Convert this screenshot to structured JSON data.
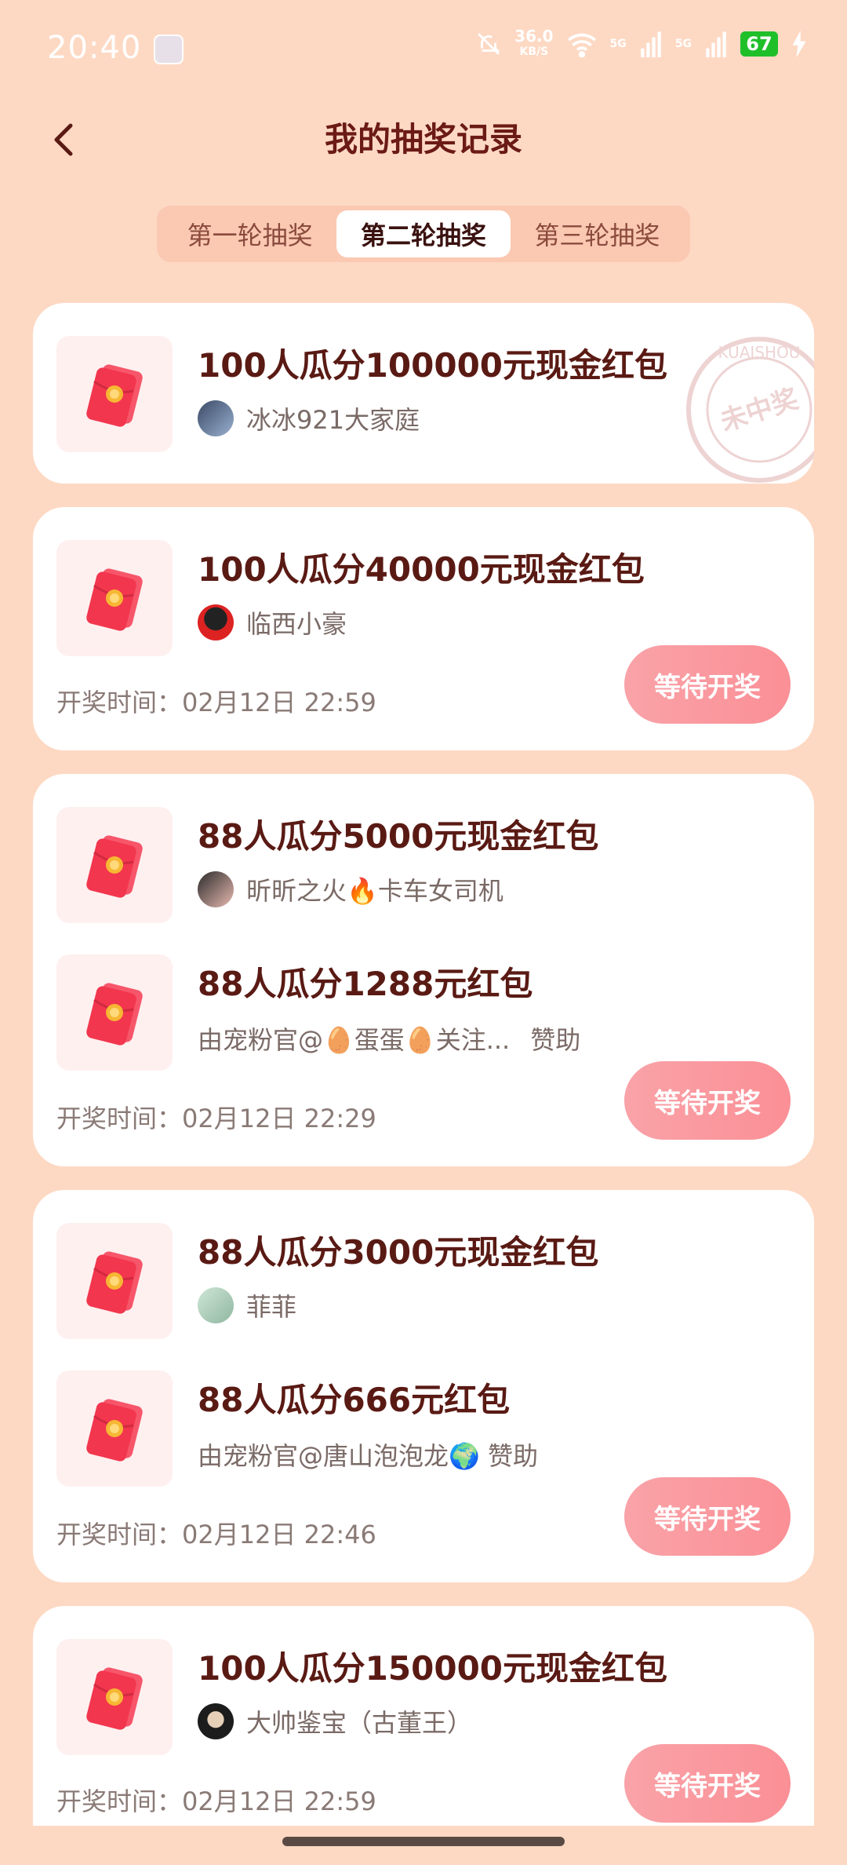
{
  "status_bar": {
    "time": "20:40",
    "net_speed": "36.0",
    "net_unit": "KB/S",
    "sig1": "5G",
    "sig2": "5G",
    "battery": "67"
  },
  "header": {
    "title": "我的抽奖记录"
  },
  "tabs": [
    {
      "label": "第一轮抽奖",
      "active": false
    },
    {
      "label": "第二轮抽奖",
      "active": true
    },
    {
      "label": "第三轮抽奖",
      "active": false
    }
  ],
  "cards": [
    {
      "rows": [
        {
          "prize": "100人瓜分100000元现金红包",
          "host": "冰冰921大家庭"
        }
      ],
      "stamp_text": "未中奖",
      "stamp_ring": "KUAISHOU"
    },
    {
      "rows": [
        {
          "prize": "100人瓜分40000元现金红包",
          "host": "临西小豪"
        }
      ],
      "draw_time": "开奖时间：02月12日 22:59",
      "button": "等待开奖"
    },
    {
      "rows": [
        {
          "prize": "88人瓜分5000元现金红包",
          "host": "昕昕之火🔥卡车女司机"
        },
        {
          "prize": "88人瓜分1288元红包",
          "sponsor_by": "由宠粉官@🥚蛋蛋🥚关注...",
          "sponsor_suffix": "赞助"
        }
      ],
      "draw_time": "开奖时间：02月12日 22:29",
      "button": "等待开奖"
    },
    {
      "rows": [
        {
          "prize": "88人瓜分3000元现金红包",
          "host": "菲菲"
        },
        {
          "prize": "88人瓜分666元红包",
          "sponsor_by": "由宠粉官@唐山泡泡龙🌍",
          "sponsor_suffix": "赞助"
        }
      ],
      "draw_time": "开奖时间：02月12日 22:46",
      "button": "等待开奖"
    },
    {
      "rows": [
        {
          "prize": "100人瓜分150000元现金红包",
          "host": "大帅鉴宝（古董王）"
        }
      ],
      "draw_time": "开奖时间：02月12日 22:59",
      "button": "等待开奖"
    }
  ],
  "colors": {
    "background": "#fdd9c4",
    "title": "#6b1a14",
    "button": "#fb8f96",
    "red_packet": "#f2364e",
    "coin": "#f7b733"
  }
}
